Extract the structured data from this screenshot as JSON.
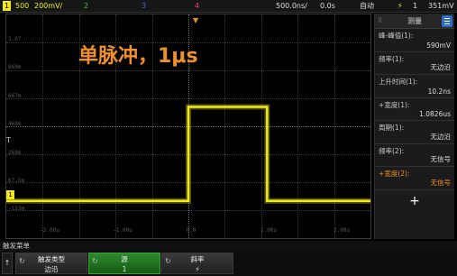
{
  "topbar": {
    "ch1_marker": "1",
    "ch1_scale": "500",
    "ch1_unit": "200mV/",
    "ch2": "2",
    "ch3": "3",
    "ch4": "4",
    "timebase": "500.0ns/",
    "delay": "0.0s",
    "trigger_mode": "自动",
    "trigger_icon": "⚡",
    "trigger_source": "1",
    "trigger_level": "351mV",
    "colors": {
      "ch1": "#f2ea1a",
      "ch2": "#2ecc40",
      "ch3": "#3a6fe0",
      "ch4": "#e0457a",
      "accent": "#f0902a"
    }
  },
  "screen": {
    "annotation": "单脉冲，1μs",
    "y_labels": [
      "1.07",
      "869m",
      "667m",
      "468m",
      "268m",
      "67.5m",
      "-133m"
    ],
    "x_labels": [
      "-2.00u",
      "-1.00u",
      "0.0",
      "1.00u",
      "2.00u"
    ],
    "ch1_marker": "1",
    "trig_marker": "T",
    "trig_top_marker": "▼"
  },
  "panel": {
    "title": "测量",
    "menu_icon": "menu-icon",
    "measurements": [
      {
        "name": "峰-峰值(1):",
        "value": "590mV"
      },
      {
        "name": "频率(1):",
        "value": "无边沿"
      },
      {
        "name": "上升时间(1):",
        "value": "10.2ns"
      },
      {
        "name": "+宽度(1):",
        "value": "1.0826us"
      },
      {
        "name": "周期(1):",
        "value": "无边沿"
      },
      {
        "name": "频率(2):",
        "value": "无信号"
      },
      {
        "name": "+宽度(2):",
        "value": "无信号",
        "highlight": true
      }
    ],
    "add_label": "+"
  },
  "softkeys": {
    "menu_title": "触发菜单",
    "back": "↑",
    "keys": [
      {
        "title": "触发类型",
        "value": "边沿",
        "active": false
      },
      {
        "title": "源",
        "value": "1",
        "active": true
      },
      {
        "title": "斜率",
        "value": "⚡",
        "active": false
      }
    ],
    "knob_icon": "↻"
  },
  "chart_data": {
    "type": "line",
    "title": "",
    "xlabel": "",
    "ylabel": "",
    "x_ticks": [
      "-2.00u",
      "-1.00u",
      "0.0",
      "1.00u",
      "2.00u"
    ],
    "y_ticks": [
      "1.07",
      "869m",
      "667m",
      "468m",
      "268m",
      "67.5m",
      "-133m"
    ],
    "xlim": [
      -2.5,
      2.5
    ],
    "ylim": [
      -0.233,
      1.17
    ],
    "series": [
      {
        "x": [
          -2.5,
          0.0,
          0.0,
          1.08,
          1.08,
          2.5
        ],
        "y": [
          0.0,
          0.0,
          0.59,
          0.59,
          0.0,
          0.0
        ]
      }
    ]
  }
}
